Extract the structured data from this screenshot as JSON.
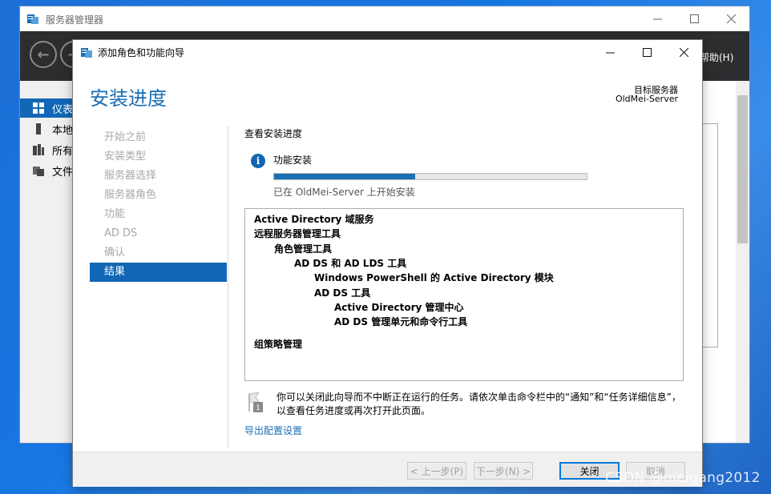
{
  "background_window": {
    "title": "服务器管理器",
    "icon": "server-manager-icon",
    "help_menu": "帮助(H)",
    "sidebar": [
      {
        "label": "仪表",
        "icon": "dashboard-icon",
        "active": true
      },
      {
        "label": "本地",
        "icon": "local-server-icon",
        "active": false
      },
      {
        "label": "所有",
        "icon": "all-servers-icon",
        "active": false
      },
      {
        "label": "文件",
        "icon": "file-services-icon",
        "active": false
      }
    ]
  },
  "dialog": {
    "title": "添加角色和功能向导",
    "heading": "安装进度",
    "target_label": "目标服务器",
    "target_server": "OldMei-Server",
    "steps": [
      {
        "label": "开始之前",
        "active": false
      },
      {
        "label": "安装类型",
        "active": false
      },
      {
        "label": "服务器选择",
        "active": false
      },
      {
        "label": "服务器角色",
        "active": false
      },
      {
        "label": "功能",
        "active": false
      },
      {
        "label": "AD DS",
        "active": false
      },
      {
        "label": "确认",
        "active": false
      },
      {
        "label": "结果",
        "active": true
      }
    ],
    "section_title": "查看安装进度",
    "feature_install_label": "功能安装",
    "progress_fraction": 0.45,
    "status_text": "已在 OldMei-Server 上开始安装",
    "results": [
      {
        "text": "Active Directory 域服务",
        "level": 0
      },
      {
        "text": "远程服务器管理工具",
        "level": 0
      },
      {
        "text": "角色管理工具",
        "level": 1
      },
      {
        "text": "AD DS 和 AD LDS 工具",
        "level": 2
      },
      {
        "text": "Windows PowerShell 的 Active Directory 模块",
        "level": 3
      },
      {
        "text": "AD DS 工具",
        "level": 3
      },
      {
        "text": "Active Directory 管理中心",
        "level": 4
      },
      {
        "text": "AD DS 管理单元和命令行工具",
        "level": 4
      },
      {
        "text": "组策略管理",
        "level": 0,
        "gap_before": true
      }
    ],
    "note_text": "你可以关闭此向导而不中断正在运行的任务。请依次单击命令栏中的“通知”和“任务详细信息”，以查看任务进度或再次打开此页面。",
    "export_link": "导出配置设置",
    "buttons": {
      "prev": "< 上一步(P)",
      "next": "下一步(N) >",
      "close": "关闭",
      "cancel": "取消"
    }
  },
  "watermark": "CSDN @meigang2012"
}
